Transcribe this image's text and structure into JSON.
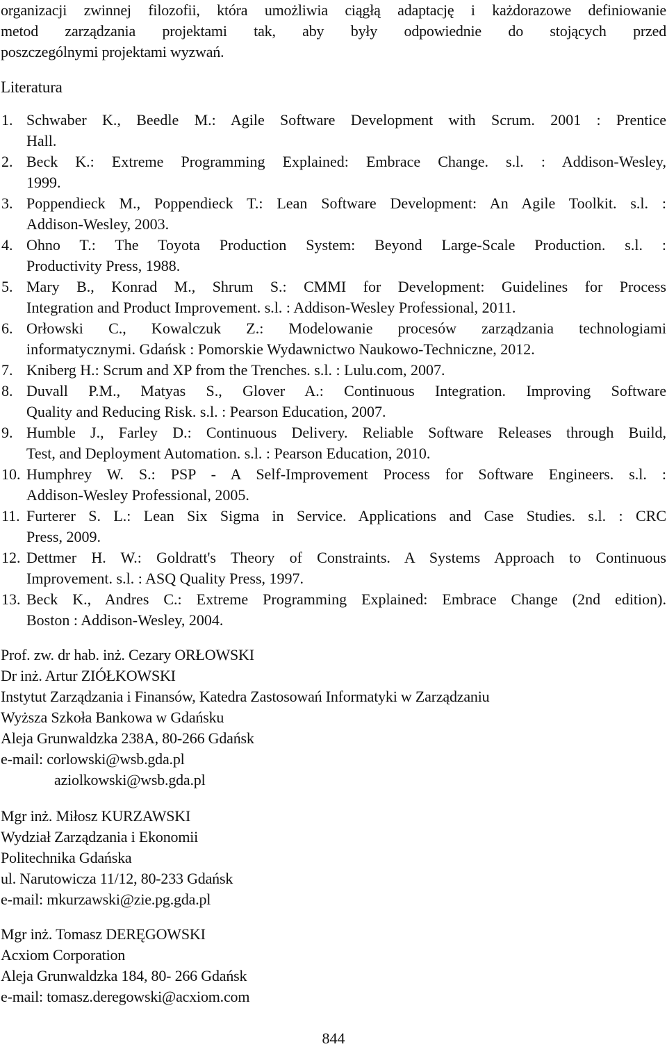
{
  "intro": {
    "lines": [
      "organizacji zwinnej filozofii, która umożliwia ciągłą adaptację i każdorazowe definiowanie",
      "metod zarządzania projektami tak, aby były odpowiednie do stojących przed",
      "poszczególnymi projektami wyzwań."
    ]
  },
  "literature": {
    "heading": "Literatura",
    "references": [
      {
        "number": "1.",
        "lines": [
          "Schwaber K., Beedle M.: Agile Software Development with Scrum. 2001 : Prentice",
          "Hall."
        ]
      },
      {
        "number": "2.",
        "lines": [
          "Beck K.: Extreme Programming Explained: Embrace Change. s.l. : Addison-Wesley,",
          "1999."
        ]
      },
      {
        "number": "3.",
        "lines": [
          "Poppendieck M., Poppendieck T.: Lean Software Development: An Agile Toolkit. s.l. :",
          "Addison-Wesley, 2003."
        ]
      },
      {
        "number": "4.",
        "lines": [
          "Ohno T.: The Toyota Production System: Beyond Large-Scale Production. s.l. :",
          "Productivity Press, 1988."
        ]
      },
      {
        "number": "5.",
        "lines": [
          "Mary B., Konrad M., Shrum S.: CMMI for Development: Guidelines for Process",
          "Integration and Product Improvement. s.l. : Addison-Wesley Professional, 2011."
        ]
      },
      {
        "number": "6.",
        "lines": [
          "Orłowski C., Kowalczuk Z.: Modelowanie procesów zarządzania technologiami",
          "informatycznymi. Gdańsk : Pomorskie Wydawnictwo Naukowo-Techniczne, 2012."
        ]
      },
      {
        "number": "7.",
        "lines": [
          "Kniberg H.: Scrum and XP from the Trenches. s.l. : Lulu.com, 2007."
        ]
      },
      {
        "number": "8.",
        "lines": [
          "Duvall P.M., Matyas S., Glover A.: Continuous Integration. Improving Software",
          "Quality and Reducing Risk. s.l. : Pearson Education, 2007."
        ]
      },
      {
        "number": "9.",
        "lines": [
          "Humble J., Farley D.: Continuous Delivery. Reliable Software Releases through Build,",
          "Test, and Deployment Automation. s.l. : Pearson Education, 2010."
        ]
      },
      {
        "number": "10.",
        "lines": [
          "Humphrey W. S.: PSP - A Self-Improvement Process for Software Engineers. s.l. :",
          "Addison-Wesley Professional, 2005."
        ]
      },
      {
        "number": "11.",
        "lines": [
          "Furterer S. L.: Lean Six Sigma in Service. Applications and Case Studies. s.l. : CRC",
          "Press, 2009."
        ]
      },
      {
        "number": "12.",
        "lines": [
          "Dettmer H. W.: Goldratt's Theory of Constraints. A Systems Approach to Continuous",
          "Improvement. s.l. : ASQ Quality Press, 1997."
        ]
      },
      {
        "number": "13.",
        "lines": [
          "Beck K., Andres C.: Extreme Programming Explained: Embrace Change (2nd edition).",
          "Boston : Addison-Wesley, 2004."
        ]
      }
    ]
  },
  "authors": [
    {
      "lines": [
        "Prof. zw. dr hab. inż. Cezary ORŁOWSKI",
        "Dr inż. Artur ZIÓŁKOWSKI",
        "Instytut Zarządzania i Finansów, Katedra Zastosowań Informatyki w Zarządzaniu",
        "Wyższa Szkoła Bankowa w Gdańsku",
        "Aleja Grunwaldzka 238A, 80-266 Gdańsk",
        "e-mail: corlowski@wsb.gda.pl"
      ],
      "extra_email": "aziolkowski@wsb.gda.pl"
    },
    {
      "lines": [
        "Mgr inż. Miłosz KURZAWSKI",
        "Wydział Zarządzania i Ekonomii",
        "Politechnika Gdańska",
        "ul. Narutowicza 11/12, 80-233 Gdańsk",
        "e-mail: mkurzawski@zie.pg.gda.pl"
      ]
    },
    {
      "lines": [
        "Mgr inż. Tomasz DERĘGOWSKI",
        "Acxiom Corporation",
        "Aleja Grunwaldzka 184, 80- 266 Gdańsk",
        "e-mail: tomasz.deregowski@acxiom.com"
      ]
    }
  ],
  "page_number": "844"
}
